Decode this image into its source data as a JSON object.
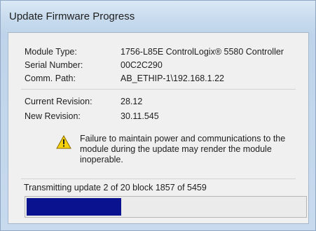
{
  "window": {
    "title": "Update Firmware Progress"
  },
  "info": {
    "module_type_label": "Module Type:",
    "module_type": "1756-L85E ControlLogix® 5580 Controller",
    "serial_label": "Serial Number:",
    "serial": "00C2C290",
    "comm_path_label": "Comm. Path:",
    "comm_path": "AB_ETHIP-1\\192.168.1.22"
  },
  "revision": {
    "current_label": "Current Revision:",
    "current": "28.12",
    "new_label": "New Revision:",
    "new": "30.11.545"
  },
  "warning": {
    "icon": "warning-icon",
    "text": "Failure to maintain power and communications to the module during the update may render the module inoperable."
  },
  "progress": {
    "status_text": "Transmitting update 2 of 20 block 1857 of 5459",
    "fraction": 0.34,
    "color": "#0a128f"
  }
}
